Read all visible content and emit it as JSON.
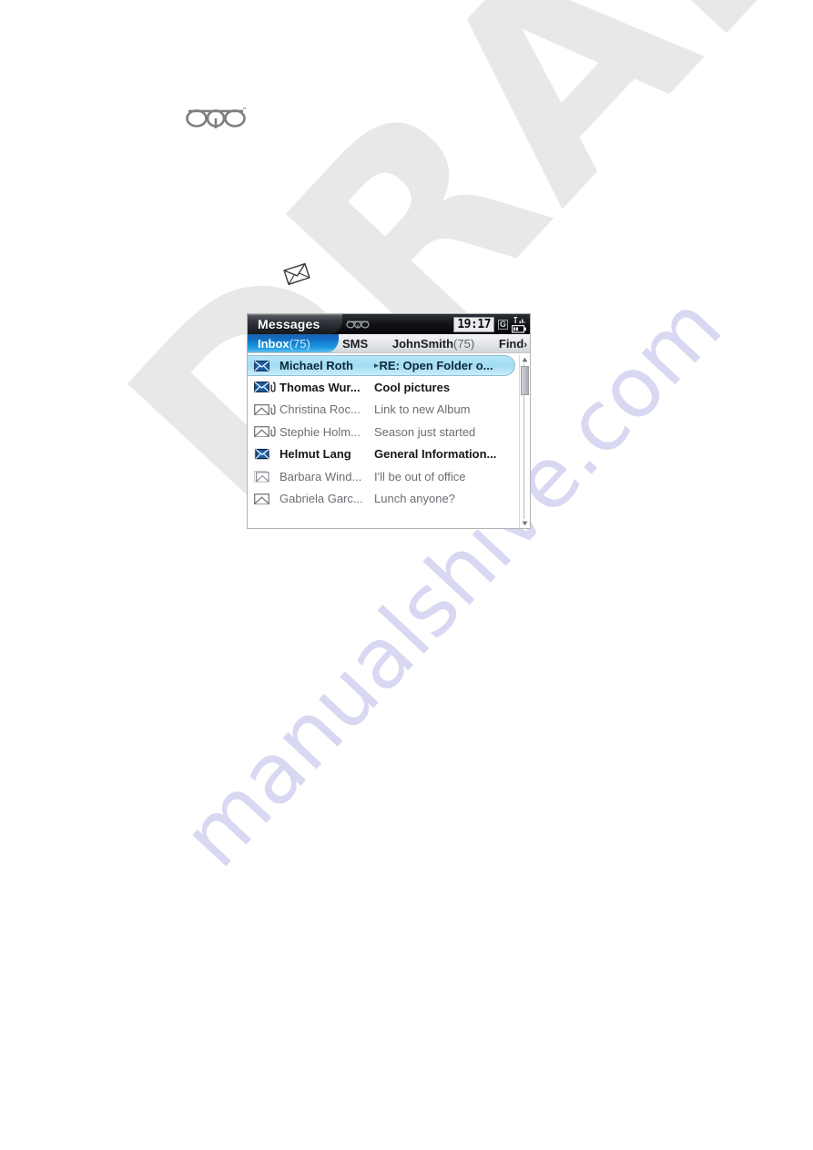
{
  "page": {
    "brand_logo": "ogo-logo",
    "figure_icon": "envelope-icon"
  },
  "watermark": {
    "draft_text": "DRAFT",
    "site_text": "manualshive.com",
    "draft_color": "#e8e8e8",
    "site_color": "#d8d8f2"
  },
  "device": {
    "titlebar": {
      "title": "Messages",
      "logo": "ogo-logo",
      "clock": "19:17",
      "gprs_indicator": "G",
      "signal_icon": "signal-bars-icon",
      "battery_icon": "battery-icon"
    },
    "tabs": {
      "active": {
        "label": "Inbox",
        "count": "(75)"
      },
      "items": [
        {
          "label": "SMS",
          "count": ""
        },
        {
          "label": "JohnSmith",
          "count": "(75)"
        }
      ],
      "find": {
        "label": "Find",
        "arrow": "›"
      }
    },
    "messages": [
      {
        "sender": "Michael Roth",
        "subject": "RE: Open Folder o...",
        "state": "selected",
        "icon": "envelope-unread-icon",
        "attachment": false,
        "marker": "▸"
      },
      {
        "sender": "Thomas Wur...",
        "subject": "Cool pictures",
        "state": "unread",
        "icon": "envelope-unread-icon",
        "attachment": true,
        "marker": ""
      },
      {
        "sender": "Christina Roc...",
        "subject": "Link to new Album",
        "state": "read",
        "icon": "envelope-open-icon",
        "attachment": true,
        "marker": ""
      },
      {
        "sender": "Stephie Holm...",
        "subject": "Season just started",
        "state": "read",
        "icon": "envelope-open-icon",
        "attachment": true,
        "marker": ""
      },
      {
        "sender": "Helmut Lang",
        "subject": "General Information...",
        "state": "unread",
        "icon": "envelope-replied-icon",
        "attachment": false,
        "marker": ""
      },
      {
        "sender": "Barbara Wind...",
        "subject": "I'll be out of office",
        "state": "read",
        "icon": "envelope-replied-faded-icon",
        "attachment": false,
        "marker": ""
      },
      {
        "sender": "Gabriela Garc...",
        "subject": "Lunch anyone?",
        "state": "read",
        "icon": "envelope-open-icon",
        "attachment": false,
        "marker": ""
      }
    ],
    "scrollbar": {
      "up_arrow": "▴",
      "down_arrow": "▾"
    },
    "colors": {
      "accent_blue": "#1c9ae0",
      "selection_blue": "#9fdcf3",
      "titlebar_dark": "#111317"
    }
  }
}
